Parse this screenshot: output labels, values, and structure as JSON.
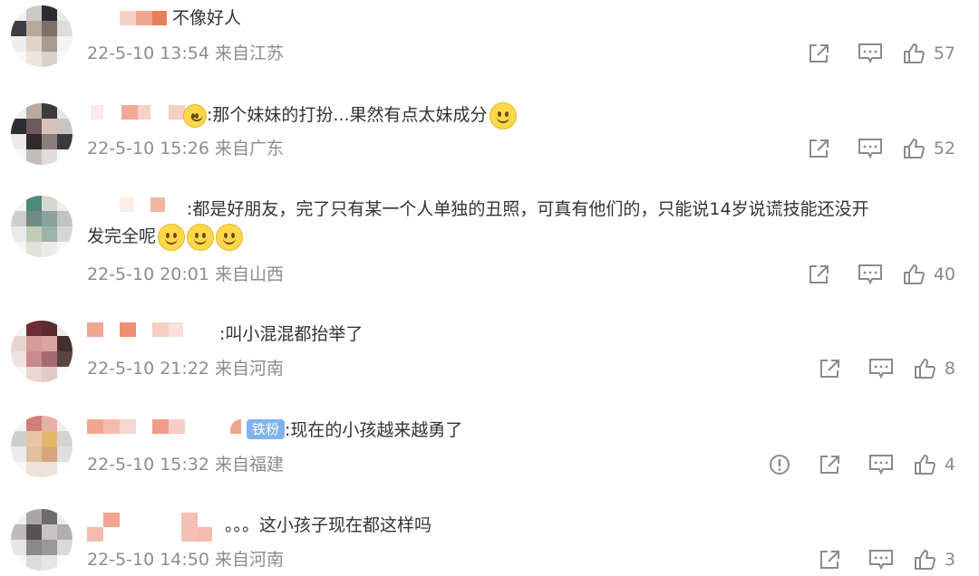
{
  "comments": [
    {
      "text": "不像好人",
      "time": "22-5-10 13:54",
      "location": "来自江苏",
      "likes": "57"
    },
    {
      "text": ":那个妹妹的打扮...果然有点太妹成分",
      "time": "22-5-10 15:26",
      "location": "来自广东",
      "likes": "52"
    },
    {
      "text": ":都是好朋友，完了只有某一个人单独的丑照，可真有他们的，只能说14岁说谎技能还没开",
      "text2": "发完全呢",
      "time": "22-5-10 20:01",
      "location": "来自山西",
      "likes": "40"
    },
    {
      "text": ":叫小混混都抬举了",
      "time": "22-5-10 21:22",
      "location": "来自河南",
      "likes": "8"
    },
    {
      "badge": "铁粉",
      "text": ":现在的小孩越来越勇了",
      "time": "22-5-10 15:32",
      "location": "来自福建",
      "likes": "4"
    },
    {
      "text": "。。。这小孩子现在都这样吗",
      "time": "22-5-10 14:50",
      "location": "来自河南",
      "likes": "3"
    }
  ],
  "icons": {
    "share": "share-icon",
    "comment": "comment-icon",
    "like": "thumbs-up-icon",
    "report": "report-icon"
  }
}
